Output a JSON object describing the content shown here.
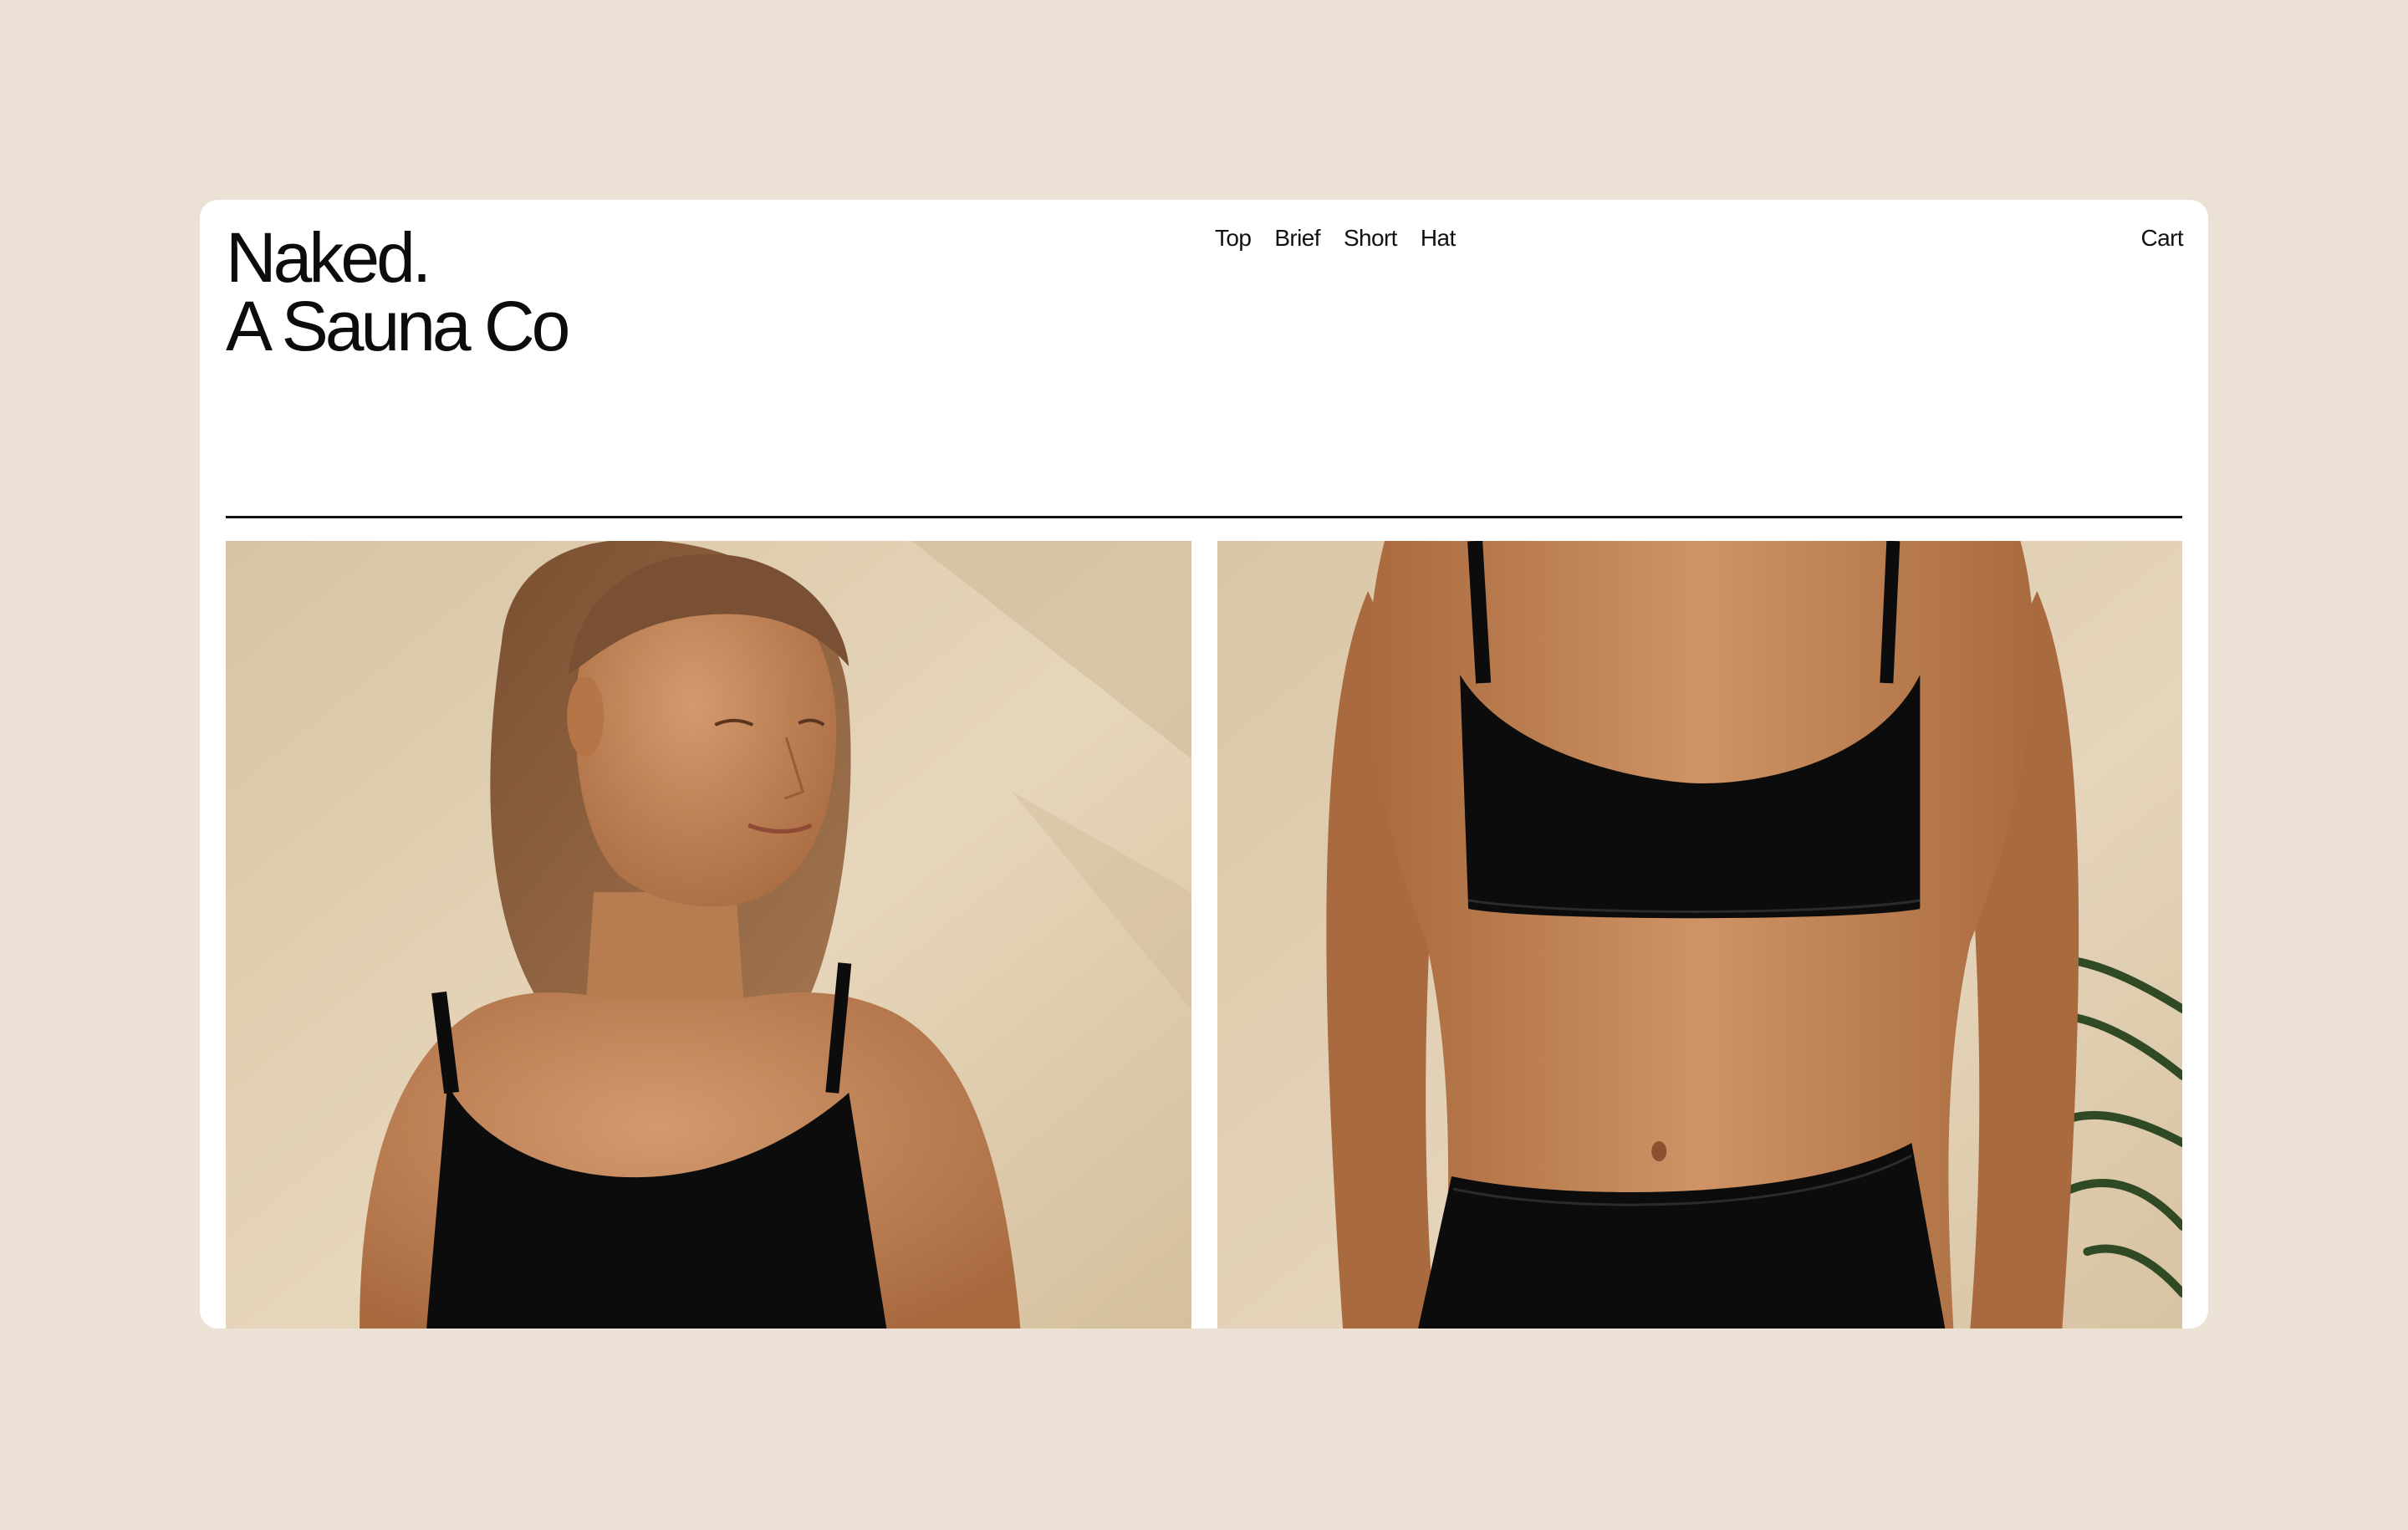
{
  "brand": {
    "line1": "Naked.",
    "line2": "A Sauna Co"
  },
  "nav": {
    "items": [
      {
        "label": "Top"
      },
      {
        "label": "Brief"
      },
      {
        "label": "Short"
      },
      {
        "label": "Hat"
      }
    ]
  },
  "header": {
    "cart_label": "Cart"
  },
  "colors": {
    "page_background": "#ebe2d5",
    "card_background": "#ffffff",
    "text": "#111111",
    "swimwear": "#0c0c0c"
  },
  "gallery": {
    "images": [
      {
        "icon": "woman-black-bikini-top-portrait-photo"
      },
      {
        "icon": "torso-black-bikini-top-and-brief-photo"
      }
    ]
  }
}
